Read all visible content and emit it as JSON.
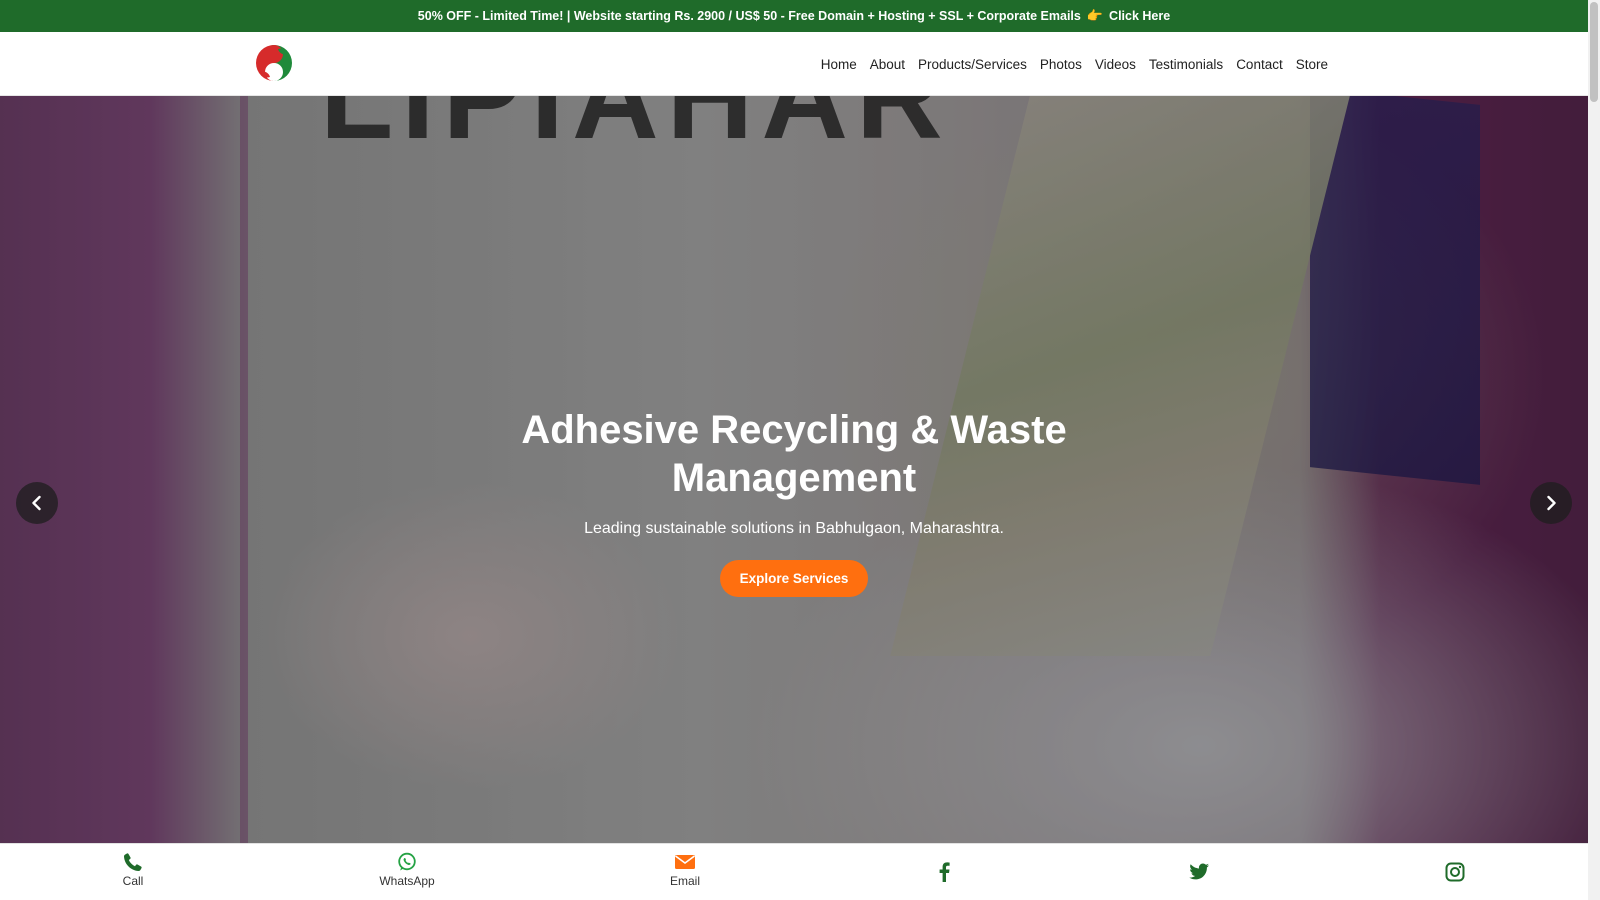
{
  "promo": {
    "text": "50% OFF - Limited Time! | Website starting Rs. 2900 / US$ 50 - Free Domain + Hosting + SSL + Corporate Emails",
    "hand": "👉",
    "link": "Click Here",
    "bg_color": "#1f6b2a"
  },
  "header": {
    "logo_icon": "yin-yang-leaf-logo",
    "nav": [
      "Home",
      "About",
      "Products/Services",
      "Photos",
      "Videos",
      "Testimonials",
      "Contact",
      "Store"
    ]
  },
  "hero": {
    "title": "Adhesive Recycling & Waste Management",
    "subtitle": "Leading sustainable solutions in Babhulgaon, Maharashtra.",
    "button": "Explore Services",
    "button_color": "#ff6f0f",
    "background_sign_text": "LIPIAHAR",
    "prev_icon": "chevron-left-icon",
    "next_icon": "chevron-right-icon"
  },
  "bottom_bar": {
    "call": {
      "label": "Call",
      "icon": "phone-icon",
      "color": "#1f6b2a"
    },
    "whatsapp": {
      "label": "WhatsApp",
      "icon": "whatsapp-icon",
      "color": "#25a244"
    },
    "email": {
      "label": "Email",
      "icon": "envelope-icon",
      "color": "#ff6f0f"
    },
    "facebook": {
      "icon": "facebook-icon",
      "color": "#1f6b2a"
    },
    "twitter": {
      "icon": "twitter-icon",
      "color": "#1f6b2a"
    },
    "instagram": {
      "icon": "instagram-icon",
      "color": "#1f6b2a"
    }
  }
}
